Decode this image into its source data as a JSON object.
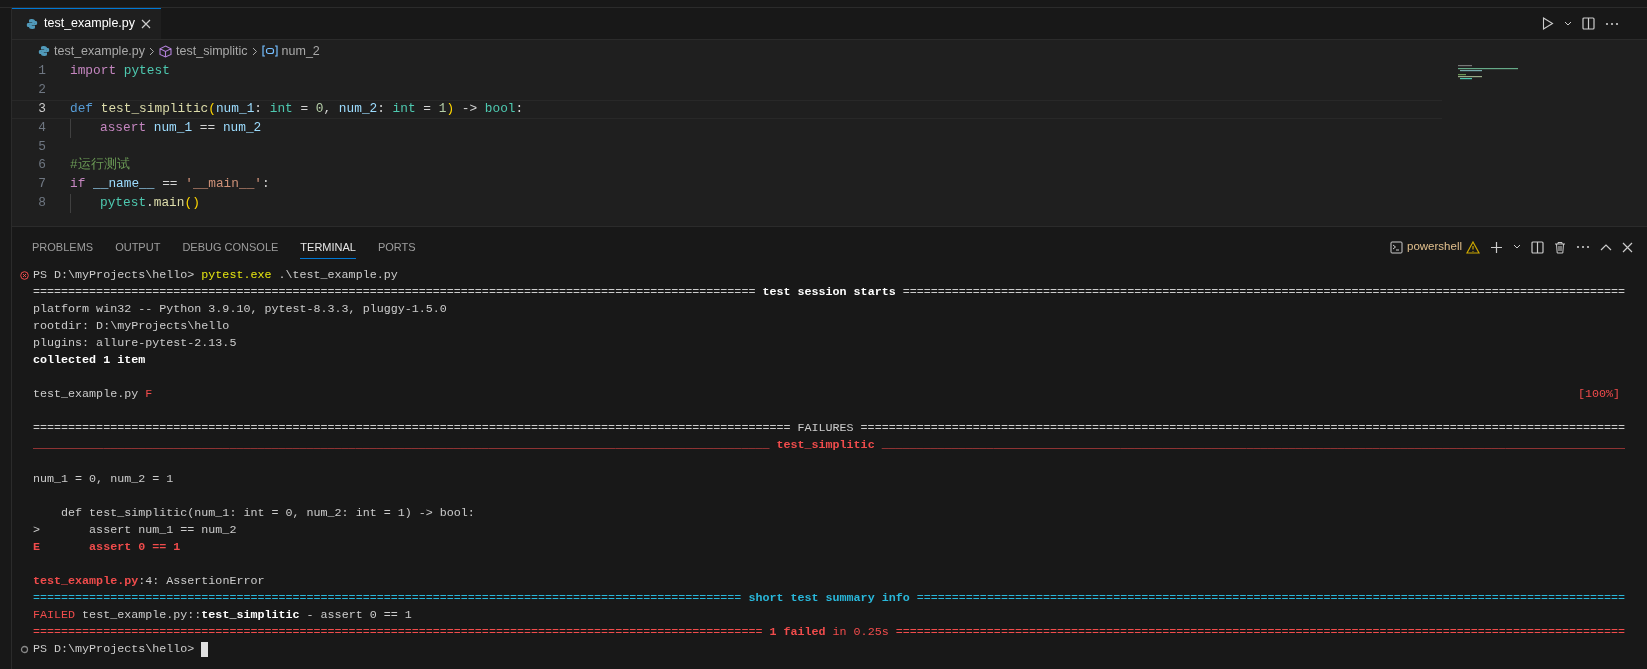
{
  "editor": {
    "tabs": [
      {
        "title": "test_example.py",
        "selected": true
      }
    ],
    "breadcrumbs": [
      {
        "kind": "file",
        "label": "test_example.py"
      },
      {
        "kind": "function",
        "label": "test_simplitic"
      },
      {
        "kind": "variable",
        "label": "num_2"
      }
    ],
    "lines": [
      {
        "number": "1",
        "current": false,
        "indented": false,
        "tokens": [
          {
            "kind": "keyword",
            "text": "import"
          },
          {
            "kind": "module",
            "text": " pytest"
          }
        ]
      },
      {
        "number": "2",
        "current": false,
        "indented": false
      },
      {
        "number": "3",
        "current": true,
        "indented": false,
        "tokens": [
          {
            "kind": "def",
            "text": "def"
          },
          {
            "kind": "func",
            "text": " test_simplitic"
          },
          {
            "kind": "paren",
            "text": "("
          },
          {
            "kind": "param",
            "text": "num_1"
          },
          {
            "kind": "op",
            "text": ": "
          },
          {
            "kind": "type",
            "text": "int"
          },
          {
            "kind": "op",
            "text": " = "
          },
          {
            "kind": "num",
            "text": "0"
          },
          {
            "kind": "op",
            "text": ", "
          },
          {
            "kind": "param",
            "text": "num_2"
          },
          {
            "kind": "op",
            "text": ": "
          },
          {
            "kind": "type",
            "text": "int"
          },
          {
            "kind": "op",
            "text": " = "
          },
          {
            "kind": "num",
            "text": "1"
          },
          {
            "kind": "paren",
            "text": ")"
          },
          {
            "kind": "op",
            "text": " -> "
          },
          {
            "kind": "type",
            "text": "bool"
          },
          {
            "kind": "op",
            "text": ":"
          }
        ]
      },
      {
        "number": "4",
        "current": false,
        "indented": true,
        "tokens": [
          {
            "kind": "keyword",
            "text": "assert"
          },
          {
            "kind": "param",
            "text": " num_1"
          },
          {
            "kind": "op",
            "text": " == "
          },
          {
            "kind": "param",
            "text": "num_2"
          }
        ]
      },
      {
        "number": "5",
        "current": false,
        "indented": false
      },
      {
        "number": "6",
        "current": false,
        "indented": false,
        "tokens": [
          {
            "kind": "comment",
            "text": "#运行测试"
          }
        ]
      },
      {
        "number": "7",
        "current": false,
        "indented": false,
        "tokens": [
          {
            "kind": "keyword",
            "text": "if"
          },
          {
            "kind": "param",
            "text": " __name__"
          },
          {
            "kind": "op",
            "text": " == "
          },
          {
            "kind": "string",
            "text": "'__main__'"
          },
          {
            "kind": "op",
            "text": ":"
          }
        ]
      },
      {
        "number": "8",
        "current": false,
        "indented": true,
        "tokens": [
          {
            "kind": "module",
            "text": "pytest"
          },
          {
            "kind": "op",
            "text": "."
          },
          {
            "kind": "func",
            "text": "main"
          },
          {
            "kind": "paren",
            "text": "()"
          }
        ]
      }
    ]
  },
  "panel": {
    "tabs": [
      {
        "label": "PROBLEMS",
        "selected": false
      },
      {
        "label": "OUTPUT",
        "selected": false
      },
      {
        "label": "DEBUG CONSOLE",
        "selected": false
      },
      {
        "label": "TERMINAL",
        "selected": true
      },
      {
        "label": "PORTS",
        "selected": false
      }
    ],
    "shell": "powershell",
    "terminal": [
      {
        "kind": "failed_command",
        "segments": [
          {
            "kind": "plain",
            "text": "PS D:\\myProjects\\hello> "
          },
          {
            "kind": "yellow",
            "text": "pytest.exe"
          },
          {
            "kind": "plain",
            "text": " .\\test_example.py"
          }
        ]
      },
      {
        "kind": "text",
        "segments": [
          {
            "kind": "plain",
            "text": "======================================================================================================= "
          },
          {
            "kind": "bold",
            "text": "test session starts"
          },
          {
            "kind": "plain",
            "text": " ======================================================================================================="
          }
        ]
      },
      {
        "kind": "text",
        "segments": [
          {
            "kind": "plain",
            "text": "platform win32 -- Python 3.9.10, pytest-8.3.3, pluggy-1.5.0"
          }
        ]
      },
      {
        "kind": "text",
        "segments": [
          {
            "kind": "plain",
            "text": "rootdir: D:\\myProjects\\hello"
          }
        ]
      },
      {
        "kind": "text",
        "segments": [
          {
            "kind": "plain",
            "text": "plugins: allure-pytest-2.13.5"
          }
        ]
      },
      {
        "kind": "text",
        "segments": [
          {
            "kind": "bold",
            "text": "collected 1 item"
          }
        ]
      },
      {
        "kind": "blank"
      },
      {
        "kind": "text",
        "segments": [
          {
            "kind": "plain",
            "text": "test_example.py "
          },
          {
            "kind": "red",
            "text": "F"
          }
        ],
        "right": {
          "kind": "red",
          "text": "[100%]"
        }
      },
      {
        "kind": "blank"
      },
      {
        "kind": "text",
        "segments": [
          {
            "kind": "plain",
            "text": "============================================================================================================ FAILURES ============================================================================================================="
          }
        ]
      },
      {
        "kind": "text",
        "segments": [
          {
            "kind": "red",
            "text": "_________________________________________________________________________________________________________ "
          },
          {
            "kind": "redbold",
            "text": "test_simplitic"
          },
          {
            "kind": "red",
            "text": " __________________________________________________________________________________________________________"
          }
        ]
      },
      {
        "kind": "blank"
      },
      {
        "kind": "text",
        "segments": [
          {
            "kind": "plain",
            "text": "num_1 = 0, num_2 = 1"
          }
        ]
      },
      {
        "kind": "blank"
      },
      {
        "kind": "text",
        "segments": [
          {
            "kind": "plain",
            "text": "    def test_simplitic(num_1: int = 0, num_2: int = 1) -> bool:"
          }
        ]
      },
      {
        "kind": "text",
        "segments": [
          {
            "kind": "plain",
            "text": ">       assert num_1 == num_2"
          }
        ]
      },
      {
        "kind": "text",
        "segments": [
          {
            "kind": "redbold",
            "text": "E       assert 0 == 1"
          }
        ]
      },
      {
        "kind": "blank"
      },
      {
        "kind": "text",
        "segments": [
          {
            "kind": "redbold",
            "text": "test_example.py"
          },
          {
            "kind": "plain",
            "text": ":4: AssertionError"
          }
        ]
      },
      {
        "kind": "text",
        "segments": [
          {
            "kind": "cyan",
            "text": "===================================================================================================== "
          },
          {
            "kind": "cyanbold",
            "text": "short test summary info"
          },
          {
            "kind": "cyan",
            "text": " ====================================================================================================="
          }
        ]
      },
      {
        "kind": "text",
        "segments": [
          {
            "kind": "red",
            "text": "FAILED"
          },
          {
            "kind": "plain",
            "text": " test_example.py::"
          },
          {
            "kind": "bold",
            "text": "test_simplitic"
          },
          {
            "kind": "plain",
            "text": " - assert 0 == 1"
          }
        ]
      },
      {
        "kind": "text",
        "segments": [
          {
            "kind": "red",
            "text": "======================================================================================================== "
          },
          {
            "kind": "redbold",
            "text": "1 failed"
          },
          {
            "kind": "red",
            "text": " in 0.25s ========================================================================================================"
          }
        ]
      },
      {
        "kind": "prompt",
        "segments": [
          {
            "kind": "plain",
            "text": "PS D:\\myProjects\\hello> "
          }
        ]
      }
    ]
  }
}
